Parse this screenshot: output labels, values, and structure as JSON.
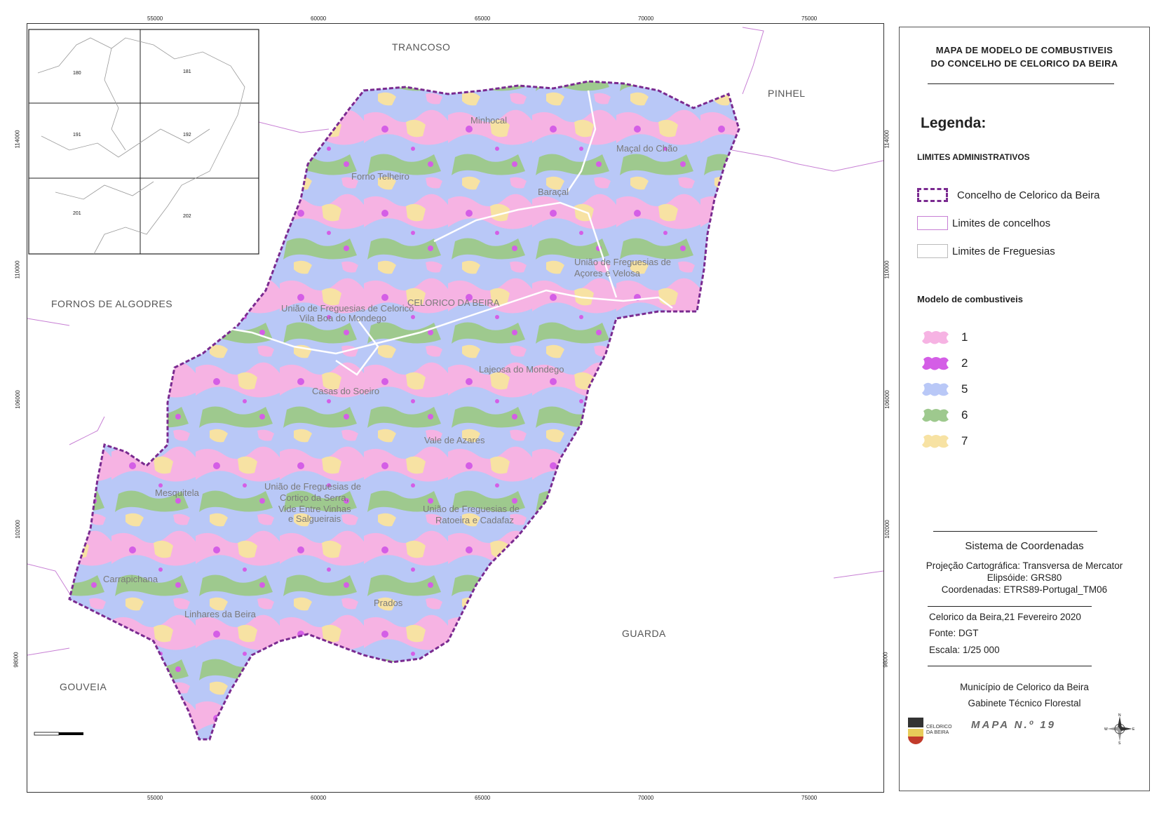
{
  "map": {
    "neighbors": [
      "TRANCOSO",
      "PINHEL",
      "FORNOS DE ALGODRES",
      "GUARDA",
      "GOUVEIA"
    ],
    "places": [
      "Minhocal",
      "Maçal do Chão",
      "Forno Telheiro",
      "Baraçal",
      "União de Freguesias de",
      "Açores e Velosa",
      "CELORICO DA BEIRA",
      "União de Freguesias de Celorico",
      "Vila Boa do Mondego",
      "Lajeosa do Mondego",
      "Casas do Soeiro",
      "Vale de Azares",
      "Mesquitela",
      "União de Freguesias de",
      "Cortiço da Serra,",
      "Vide Entre Vinhas",
      "e Salgueirais",
      "União de Freguesias de",
      "Ratoeira e Cadafaz",
      "Carrapichana",
      "Prados",
      "Linhares da Beira"
    ],
    "inset_labels": [
      "180",
      "181",
      "191",
      "192",
      "201",
      "202"
    ],
    "x_ticks": [
      "55000",
      "60000",
      "65000",
      "70000",
      "75000"
    ],
    "y_ticks": [
      "114000",
      "110000",
      "106000",
      "102000",
      "98000"
    ]
  },
  "legend": {
    "title_line1": "MAPA DE MODELO DE COMBUSTIVEIS",
    "title_line2": "DO CONCELHO DE CELORICO DA BEIRA",
    "legenda": "Legenda:",
    "admin_header": "LIMITES ADMINISTRATIVOS",
    "admin_items": [
      "Concelho de Celorico da Beira",
      "Limites de concelhos",
      "Limites de Freguesias"
    ],
    "fuel_header": "Modelo de combustiveis",
    "fuel_items": [
      {
        "label": "1",
        "color": "#f6b3e3"
      },
      {
        "label": "2",
        "color": "#d45ee6"
      },
      {
        "label": "5",
        "color": "#b9c8f7"
      },
      {
        "label": "6",
        "color": "#9ec98e"
      },
      {
        "label": "7",
        "color": "#f7e2a3"
      }
    ]
  },
  "coords": {
    "title": "Sistema de Coordenadas",
    "line1": "Projeção Cartográfica: Transversa de Mercator",
    "line2": "Elipsóide: GRS80",
    "line3": "Coordenadas: ETRS89-Portugal_TM06"
  },
  "info": {
    "date": "Celorico da Beira,21 Fevereiro 2020",
    "source": "Fonte: DGT",
    "scale": "Escala: 1/25 000"
  },
  "credits": {
    "line1": "Município de Celorico da Beira",
    "line2": "Gabinete Técnico Florestal",
    "map_number": "MAPA N.º 19",
    "logo_text": "CELORICO DA BEIRA",
    "compass": [
      "N",
      "W",
      "E",
      "S"
    ]
  }
}
